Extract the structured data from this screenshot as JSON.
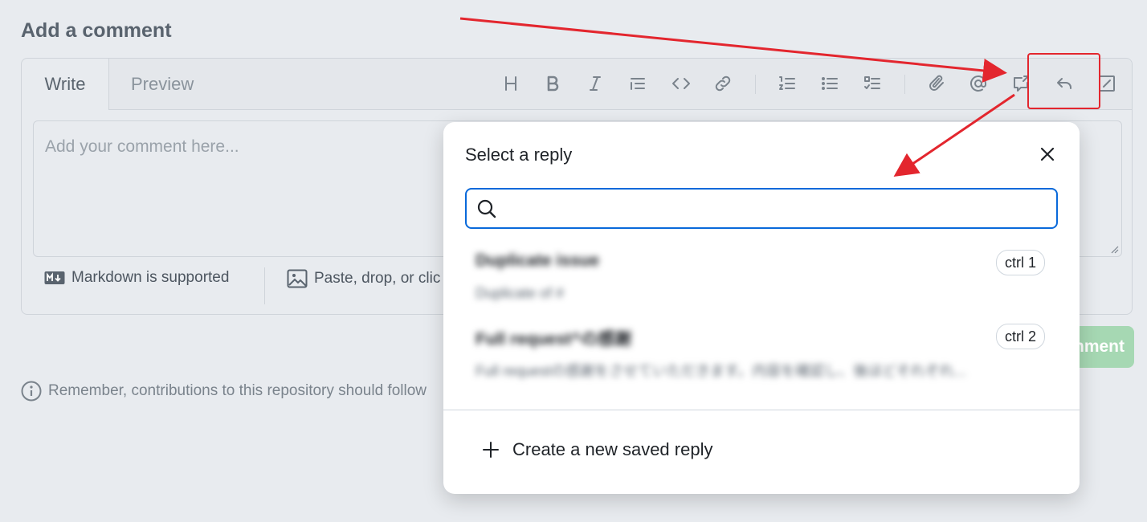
{
  "header": {
    "title": "Add a comment"
  },
  "tabs": {
    "write": "Write",
    "preview": "Preview"
  },
  "toolbar": {
    "icons": [
      "heading-icon",
      "bold-icon",
      "italic-icon",
      "quote-icon",
      "code-icon",
      "link-icon",
      "numbered-list-icon",
      "unordered-list-icon",
      "task-list-icon",
      "attach-icon",
      "mention-icon",
      "cross-reference-icon",
      "saved-reply-icon",
      "slash-commands-icon"
    ]
  },
  "editor": {
    "placeholder": "Add your comment here..."
  },
  "footer": {
    "markdown": "Markdown is supported",
    "paste": "Paste, drop, or clic"
  },
  "remember": "Remember, contributions to this repository should follow",
  "submit": {
    "label": "nment"
  },
  "popup": {
    "title": "Select a reply",
    "search_placeholder": "",
    "replies": [
      {
        "title": "Duplicate issue",
        "desc": "Duplicate of #",
        "shortcut": "ctrl 1"
      },
      {
        "title": "Full request^の感謝",
        "desc": "Full requestの感謝をさせていただきます。内容を確認し、後ほどそれぞれ...",
        "shortcut": "ctrl 2"
      }
    ],
    "create": "Create a new saved reply"
  },
  "colors": {
    "accent": "#0969da",
    "annotation": "#e3262e",
    "submit": "#a6d8b3"
  }
}
